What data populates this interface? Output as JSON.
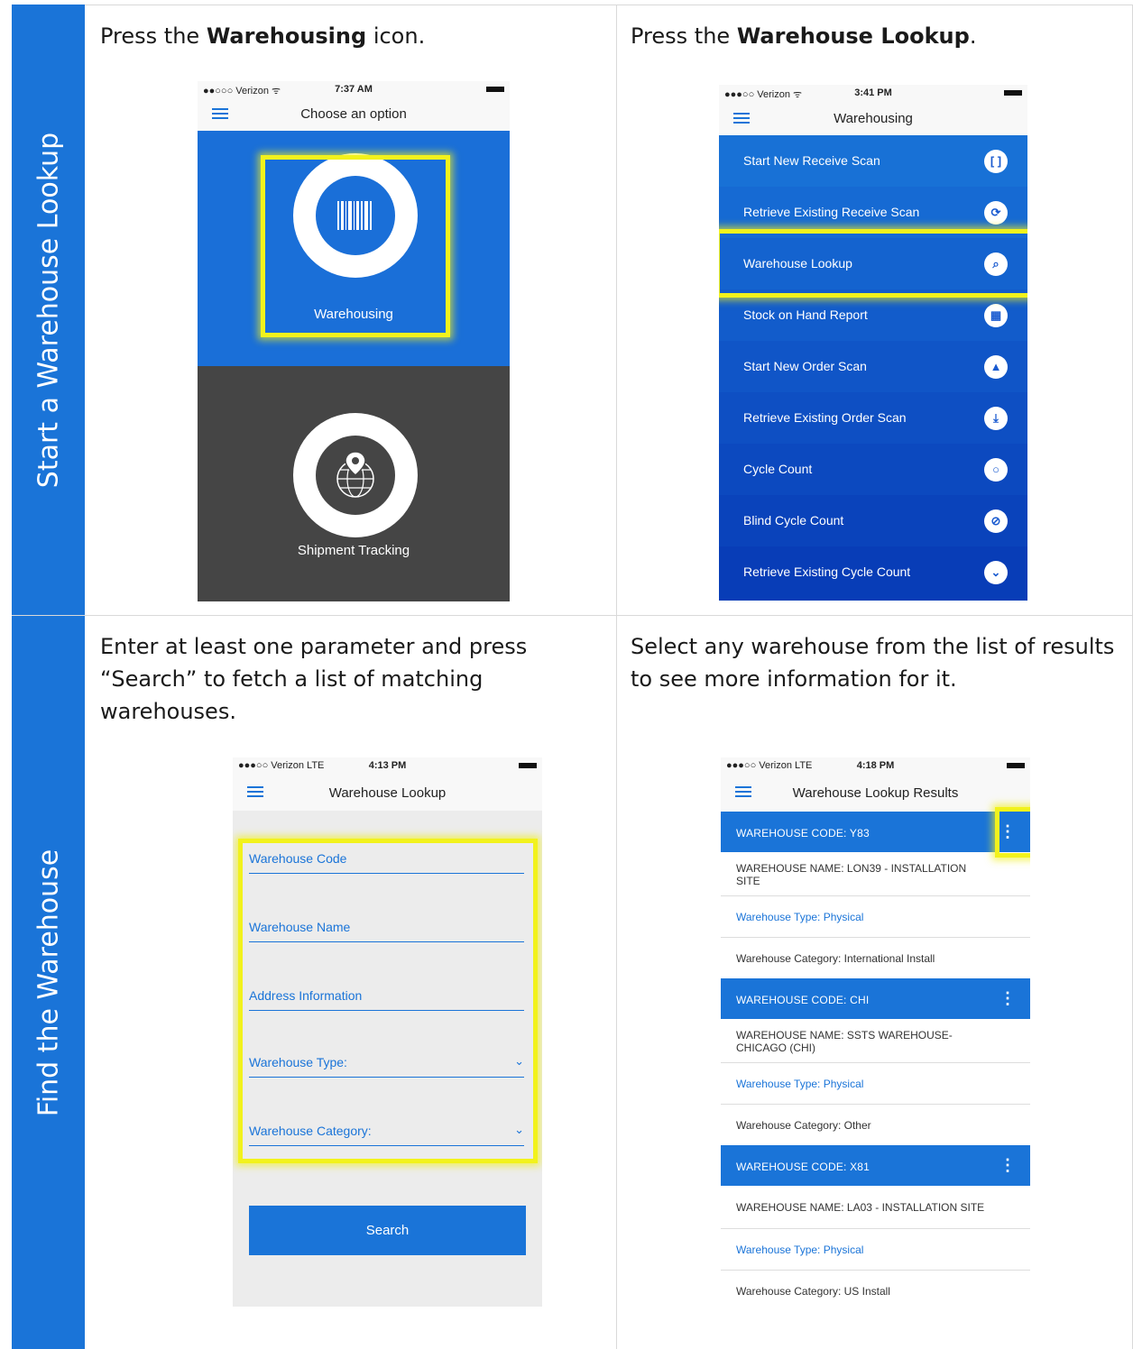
{
  "sections": {
    "start": "Start a Warehouse Lookup",
    "find": "Find the Warehouse"
  },
  "steps": {
    "s1_pre": "Press the ",
    "s1_bold": "Warehousing",
    "s1_post": " icon.",
    "s2_pre": "Press the ",
    "s2_bold": "Warehouse Lookup",
    "s2_post": ".",
    "s3_line1": "Enter at least one parameter and press",
    "s3_line2": "“Search” to fetch a list of matching",
    "s3_line3": "warehouses.",
    "s4_line1": "Select any warehouse from the list of results",
    "s4_line2": "to see more information for it."
  },
  "phone1": {
    "carrier": "●●○○○ Verizon ᯤ",
    "time": "7:37 AM",
    "title": "Choose an option",
    "option1": "Warehousing",
    "option2": "Shipment Tracking",
    "colors": {
      "top": "#1a6fd8",
      "bottom": "#454545"
    }
  },
  "phone2": {
    "carrier": "●●●○○ Verizon ᯤ",
    "time": "3:41 PM",
    "title": "Warehousing",
    "menu": [
      {
        "label": "Start New Receive Scan",
        "icon": "[ ]"
      },
      {
        "label": "Retrieve Existing Receive Scan",
        "icon": "⟳"
      },
      {
        "label": "Warehouse Lookup",
        "icon": "⌕"
      },
      {
        "label": "Stock on Hand Report",
        "icon": "▦"
      },
      {
        "label": "Start New Order Scan",
        "icon": "▲"
      },
      {
        "label": "Retrieve Existing Order Scan",
        "icon": "⤓"
      },
      {
        "label": "Cycle Count",
        "icon": "○"
      },
      {
        "label": "Blind Cycle Count",
        "icon": "⊘"
      },
      {
        "label": "Retrieve Existing Cycle Count",
        "icon": "⌄"
      }
    ]
  },
  "phone3": {
    "carrier": "●●●○○ Verizon  LTE",
    "time": "4:13 PM",
    "title": "Warehouse Lookup",
    "fields": [
      "Warehouse Code",
      "Warehouse Name",
      "Address Information",
      "Warehouse Type:",
      "Warehouse Category:"
    ],
    "search": "Search"
  },
  "phone4": {
    "carrier": "●●●○○ Verizon  LTE",
    "time": "4:18 PM",
    "title": "Warehouse Lookup Results",
    "results": [
      {
        "code": "WAREHOUSE CODE: Y83",
        "name1": "WAREHOUSE NAME: LON39 - INSTALLATION",
        "name2": "SITE",
        "type": "Warehouse Type:  Physical",
        "category": "Warehouse Category:  International Install"
      },
      {
        "code": "WAREHOUSE CODE: CHI",
        "name1": "WAREHOUSE NAME: SSTS WAREHOUSE-",
        "name2": "CHICAGO (CHI)",
        "type": "Warehouse Type:  Physical",
        "category": "Warehouse Category:  Other"
      },
      {
        "code": "WAREHOUSE CODE: X81",
        "name1": "WAREHOUSE NAME: LA03 - INSTALLATION SITE",
        "name2": "",
        "type": "Warehouse Type:  Physical",
        "category": "Warehouse Category:  US Install"
      }
    ]
  }
}
